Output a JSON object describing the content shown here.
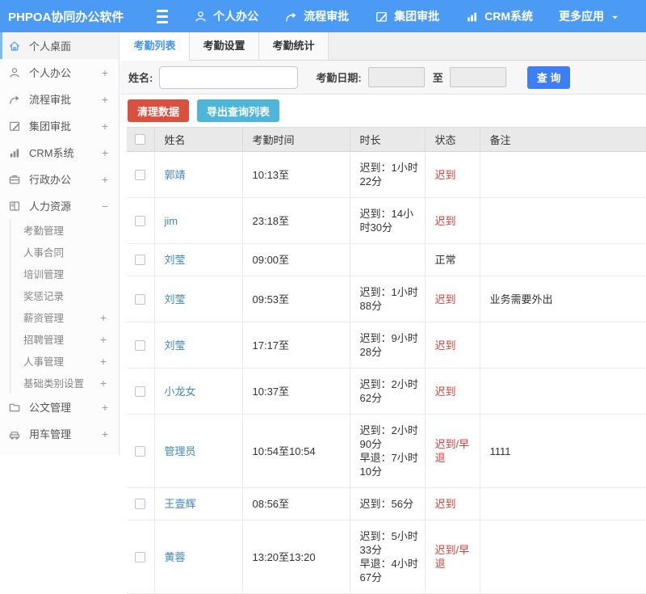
{
  "topbar": {
    "title": "PHPOA协同办公软件",
    "menu": [
      {
        "label": "个人办公",
        "icon": "person"
      },
      {
        "label": "流程审批",
        "icon": "flow"
      },
      {
        "label": "集团审批",
        "icon": "edit"
      },
      {
        "label": "CRM系统",
        "icon": "chart"
      },
      {
        "label": "更多应用",
        "icon": null,
        "caret": true
      }
    ]
  },
  "sidebar": {
    "items": [
      {
        "label": "个人桌面",
        "icon": "home",
        "active": true
      },
      {
        "label": "个人办公",
        "icon": "person",
        "expand": "+"
      },
      {
        "label": "流程审批",
        "icon": "flow",
        "expand": "+"
      },
      {
        "label": "集团审批",
        "icon": "edit",
        "expand": "+"
      },
      {
        "label": "CRM系统",
        "icon": "chart",
        "expand": "+"
      },
      {
        "label": "行政办公",
        "icon": "briefcase",
        "expand": "+"
      },
      {
        "label": "人力资源",
        "icon": "book",
        "expand": "−",
        "children": [
          {
            "label": "考勤管理"
          },
          {
            "label": "人事合同"
          },
          {
            "label": "培训管理"
          },
          {
            "label": "奖惩记录"
          },
          {
            "label": "薪资管理",
            "expand": "+"
          },
          {
            "label": "招聘管理",
            "expand": "+"
          },
          {
            "label": "人事管理",
            "expand": "+"
          },
          {
            "label": "基础类别设置",
            "expand": "+"
          }
        ]
      },
      {
        "label": "公文管理",
        "icon": "folder",
        "expand": "+"
      },
      {
        "label": "用车管理",
        "icon": "car",
        "expand": "+"
      }
    ]
  },
  "tabs": [
    {
      "label": "考勤列表",
      "active": true
    },
    {
      "label": "考勤设置",
      "active": false
    },
    {
      "label": "考勤统计",
      "active": false
    }
  ],
  "search": {
    "name_label": "姓名:",
    "name_value": "",
    "date_label": "考勤日期:",
    "date_from_value": "",
    "to_label": "至",
    "date_to_value": "",
    "query_button": "查 询"
  },
  "toolbar": {
    "clean_button": "清理数据",
    "export_button": "导出查询列表"
  },
  "table": {
    "columns": [
      "姓名",
      "考勤时间",
      "时长",
      "状态",
      "备注"
    ],
    "rows": [
      {
        "name": "郭靖",
        "time": "10:13至",
        "duration": "迟到：1小时22分",
        "status": "迟到",
        "status_type": "late",
        "note": ""
      },
      {
        "name": "jim",
        "time": "23:18至",
        "duration": "迟到：14小时30分",
        "status": "迟到",
        "status_type": "late",
        "note": ""
      },
      {
        "name": "刘莹",
        "time": "09:00至",
        "duration": "",
        "status": "正常",
        "status_type": "normal",
        "note": ""
      },
      {
        "name": "刘莹",
        "time": "09:53至",
        "duration": "迟到：1小时88分",
        "status": "迟到",
        "status_type": "late",
        "note": "业务需要外出"
      },
      {
        "name": "刘莹",
        "time": "17:17至",
        "duration": "迟到：9小时28分",
        "status": "迟到",
        "status_type": "late",
        "note": ""
      },
      {
        "name": "小龙女",
        "time": "10:37至",
        "duration": "迟到：2小时62分",
        "status": "迟到",
        "status_type": "late",
        "note": ""
      },
      {
        "name": "管理员",
        "time": "10:54至10:54",
        "duration": "迟到：2小时90分\n早退：7小时10分",
        "status": "迟到/早退",
        "status_type": "late-early",
        "note": "1111"
      },
      {
        "name": "王壹辉",
        "time": "08:56至",
        "duration": "迟到：56分",
        "status": "迟到",
        "status_type": "late",
        "note": ""
      },
      {
        "name": "黄蓉",
        "time": "13:20至13:20",
        "duration": "迟到：5小时33分\n早退：4小时67分",
        "status": "迟到/早退",
        "status_type": "late-early",
        "note": ""
      }
    ]
  },
  "colors": {
    "topbar_bg": "#4b9bf5",
    "accent_blue": "#3d7ef4",
    "danger_red": "#d9503f",
    "export_teal": "#4fb6d9",
    "link_blue": "#3d87c3",
    "status_red": "#d6403a"
  }
}
